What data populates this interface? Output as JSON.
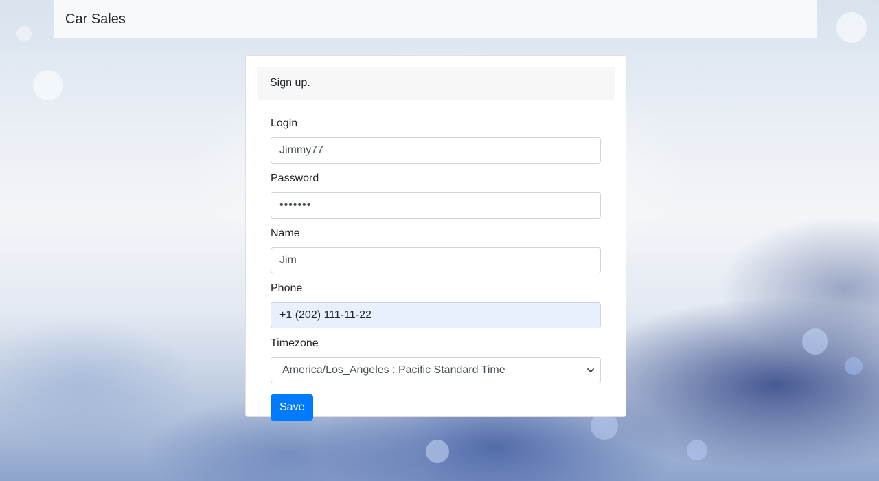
{
  "navbar": {
    "brand": "Car Sales"
  },
  "form": {
    "header": "Sign up.",
    "login": {
      "label": "Login",
      "value": "Jimmy77"
    },
    "password": {
      "label": "Password",
      "value": "•••••••"
    },
    "name": {
      "label": "Name",
      "value": "Jim"
    },
    "phone": {
      "label": "Phone",
      "value": "+1 (202) 111-11-22"
    },
    "timezone": {
      "label": "Timezone",
      "selected": "America/Los_Angeles : Pacific Standard Time"
    },
    "save_label": "Save"
  },
  "colors": {
    "primary": "#007bff",
    "navbar_bg": "#f8f9fa",
    "autofill_bg": "#e8f0fe"
  }
}
